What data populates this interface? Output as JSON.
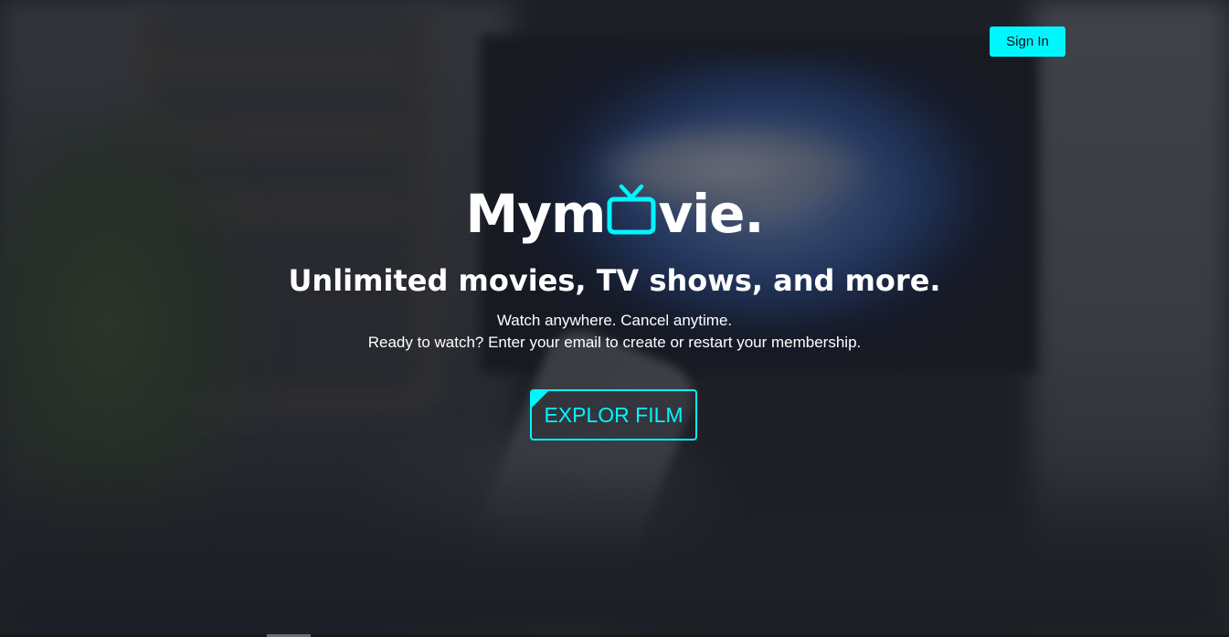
{
  "header": {
    "signin_label": "Sign In"
  },
  "logo": {
    "text_before_icon": "Mym",
    "icon": "tv-icon",
    "text_after_icon": "vie."
  },
  "hero": {
    "tagline": "Unlimited movies, TV shows, and more.",
    "subline_1": "Watch anywhere. Cancel anytime.",
    "subline_2": "Ready to watch? Enter your email to create or restart your membership.",
    "cta_label": "EXPLOR FILM"
  },
  "colors": {
    "accent": "#00f6ff",
    "text": "#ffffff",
    "background": "#23262c"
  }
}
